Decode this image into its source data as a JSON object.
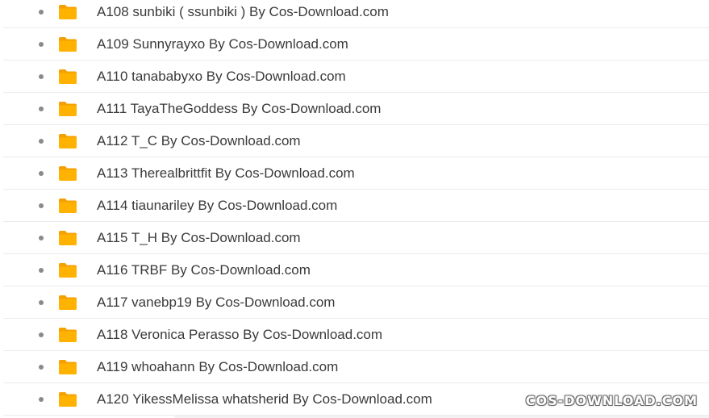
{
  "folders": [
    {
      "label": "A108 sunbiki ( ssunbiki ) By Cos-Download.com",
      "icon": "folder-icon"
    },
    {
      "label": "A109 Sunnyrayxo By Cos-Download.com",
      "icon": "folder-icon"
    },
    {
      "label": "A110 tanababyxo By Cos-Download.com",
      "icon": "folder-icon"
    },
    {
      "label": "A111 TayaTheGoddess By Cos-Download.com",
      "icon": "folder-icon"
    },
    {
      "label": "A112 T_C By Cos-Download.com",
      "icon": "folder-icon"
    },
    {
      "label": "A113 Therealbrittfit By Cos-Download.com",
      "icon": "folder-icon"
    },
    {
      "label": "A114 tiaunariley By Cos-Download.com",
      "icon": "folder-icon"
    },
    {
      "label": "A115 T_H By Cos-Download.com",
      "icon": "folder-icon"
    },
    {
      "label": "A116 TRBF By Cos-Download.com",
      "icon": "folder-icon"
    },
    {
      "label": "A117 vanebp19 By Cos-Download.com",
      "icon": "folder-icon"
    },
    {
      "label": "A118 Veronica Perasso By Cos-Download.com",
      "icon": "folder-icon"
    },
    {
      "label": "A119 whoahann By Cos-Download.com",
      "icon": "folder-icon"
    },
    {
      "label": "A120 YikessMelissa whatsherid By Cos-Download.com",
      "icon": "folder-icon"
    }
  ],
  "watermark": "COS-DOWNLOAD.COM",
  "colors": {
    "folder": "#FFB300",
    "folder_back": "#F5A000",
    "text": "#3a3a3a",
    "bullet": "#8a8a8a",
    "divider": "#ebebeb"
  }
}
